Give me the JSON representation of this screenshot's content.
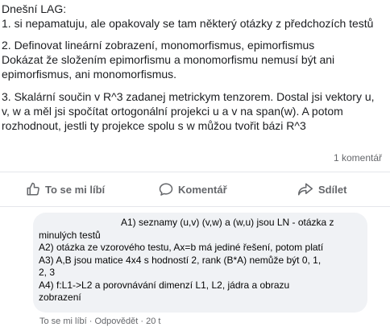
{
  "post": {
    "paragraphs": [
      [
        "Dnešní LAG:",
        "1. si nepamatuju, ale opakovaly se tam některý otázky z předchozích testů"
      ],
      [
        "2. Definovat lineární zobrazení, monomorfismus, epimorfismus",
        "Dokázat že složením epimorfismu a monomorfismu nemusí být ani",
        "epimorfismus, ani monomorfismus."
      ],
      [
        "3. Skalární součin v R^3 zadanej metrickym tenzorem. Dostal jsi vektory u,",
        "v, w a měl jsi spočítat ortogonální projekci u a v na span(w). A potom",
        "rozhodnout, jestli ty projekce spolu s w můžou tvořit bázi R^3"
      ]
    ]
  },
  "meta": {
    "comment_count": "1 komentář"
  },
  "actions": {
    "like": "To se mi líbí",
    "comment": "Komentář",
    "share": "Sdílet"
  },
  "comment": {
    "lines": [
      "A1) seznamy (u,v) (v,w) a (w,u) jsou LN - otázka z",
      "minulých testů",
      "A2) otázka ze vzorového testu, Ax=b má jediné řešení, potom platí",
      "A3) A,B jsou matice 4x4 s hodností 2, rank (B*A) nemůže být 0, 1,",
      "2, 3",
      "A4) f:L1->L2 a porovnávání dimenzí L1, L2, jádra a obrazu",
      "zobrazení"
    ],
    "footer": {
      "like": "To se mi líbí",
      "reply": "Odpovědět",
      "time": "20 t"
    }
  },
  "icons": {
    "like": "thumbs-up-icon",
    "comment": "comment-bubble-icon",
    "share": "share-arrow-icon"
  },
  "colors": {
    "text": "#1c1e21",
    "secondary": "#65676b",
    "bubble": "#f0f2f5"
  }
}
